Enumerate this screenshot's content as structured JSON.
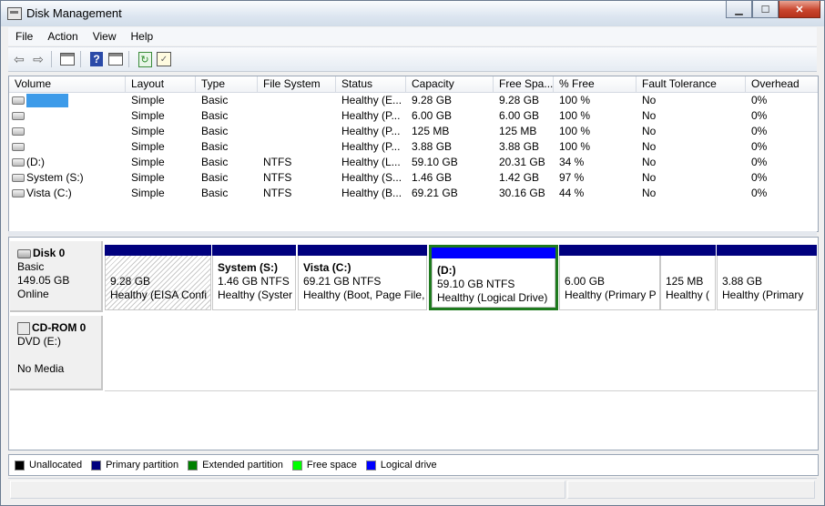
{
  "window": {
    "title": "Disk Management",
    "buttons": {
      "minimize": "▁",
      "maximize": "☐",
      "close": "✕"
    }
  },
  "menu": [
    "File",
    "Action",
    "View",
    "Help"
  ],
  "toolbar_icons": [
    "back-icon",
    "forward-icon",
    "show-hide-console-tree-icon",
    "help-icon",
    "properties-icon",
    "refresh-icon",
    "rescan-disks-icon"
  ],
  "columns": [
    "Volume",
    "Layout",
    "Type",
    "File System",
    "Status",
    "Capacity",
    "Free Spa...",
    "% Free",
    "Fault Tolerance",
    "Overhead"
  ],
  "volumes": [
    {
      "name": "",
      "redacted": true,
      "layout": "Simple",
      "type": "Basic",
      "fs": "",
      "status": "Healthy (E...",
      "capacity": "9.28 GB",
      "free": "9.28 GB",
      "pct": "100 %",
      "fault": "No",
      "overhead": "0%"
    },
    {
      "name": "",
      "redacted": false,
      "layout": "Simple",
      "type": "Basic",
      "fs": "",
      "status": "Healthy (P...",
      "capacity": "6.00 GB",
      "free": "6.00 GB",
      "pct": "100 %",
      "fault": "No",
      "overhead": "0%"
    },
    {
      "name": "",
      "redacted": false,
      "layout": "Simple",
      "type": "Basic",
      "fs": "",
      "status": "Healthy (P...",
      "capacity": "125 MB",
      "free": "125 MB",
      "pct": "100 %",
      "fault": "No",
      "overhead": "0%"
    },
    {
      "name": "",
      "redacted": false,
      "layout": "Simple",
      "type": "Basic",
      "fs": "",
      "status": "Healthy (P...",
      "capacity": "3.88 GB",
      "free": "3.88 GB",
      "pct": "100 %",
      "fault": "No",
      "overhead": "0%"
    },
    {
      "name": "(D:)",
      "redacted": false,
      "layout": "Simple",
      "type": "Basic",
      "fs": "NTFS",
      "status": "Healthy (L...",
      "capacity": "59.10 GB",
      "free": "20.31 GB",
      "pct": "34 %",
      "fault": "No",
      "overhead": "0%"
    },
    {
      "name": "System (S:)",
      "redacted": false,
      "layout": "Simple",
      "type": "Basic",
      "fs": "NTFS",
      "status": "Healthy (S...",
      "capacity": "1.46 GB",
      "free": "1.42 GB",
      "pct": "97 %",
      "fault": "No",
      "overhead": "0%"
    },
    {
      "name": "Vista (C:)",
      "redacted": false,
      "layout": "Simple",
      "type": "Basic",
      "fs": "NTFS",
      "status": "Healthy (B...",
      "capacity": "69.21 GB",
      "free": "30.16 GB",
      "pct": "44 %",
      "fault": "No",
      "overhead": "0%"
    }
  ],
  "disk0": {
    "name": "Disk 0",
    "type": "Basic",
    "size": "149.05 GB",
    "state": "Online",
    "partitions": [
      {
        "name": "",
        "line1": "9.28 GB",
        "line2": "Healthy (EISA Confi",
        "style": "unallocated-hatch"
      },
      {
        "name": "System  (S:)",
        "line1": "1.46 GB NTFS",
        "line2": "Healthy (Syster",
        "style": "primary"
      },
      {
        "name": "Vista  (C:)",
        "line1": "69.21 GB NTFS",
        "line2": "Healthy (Boot, Page File,",
        "style": "primary"
      },
      {
        "name": "(D:)",
        "line1": "59.10 GB NTFS",
        "line2": "Healthy (Logical Drive)",
        "style": "logical",
        "selected": true
      },
      {
        "name": "",
        "line1": "6.00 GB",
        "line2": "Healthy (Primary P",
        "style": "primary"
      },
      {
        "name": "",
        "line1": "125 MB",
        "line2": "Healthy (",
        "style": "primary"
      },
      {
        "name": "",
        "line1": "3.88 GB",
        "line2": "Healthy (Primary",
        "style": "primary"
      }
    ]
  },
  "cdrom0": {
    "name": "CD-ROM 0",
    "type": "DVD (E:)",
    "state": "No Media"
  },
  "legend": [
    {
      "label": "Unallocated",
      "color": "#000000"
    },
    {
      "label": "Primary partition",
      "color": "#00007e"
    },
    {
      "label": "Extended partition",
      "color": "#008000"
    },
    {
      "label": "Free space",
      "color": "#00ff00"
    },
    {
      "label": "Logical drive",
      "color": "#0000ff"
    }
  ]
}
